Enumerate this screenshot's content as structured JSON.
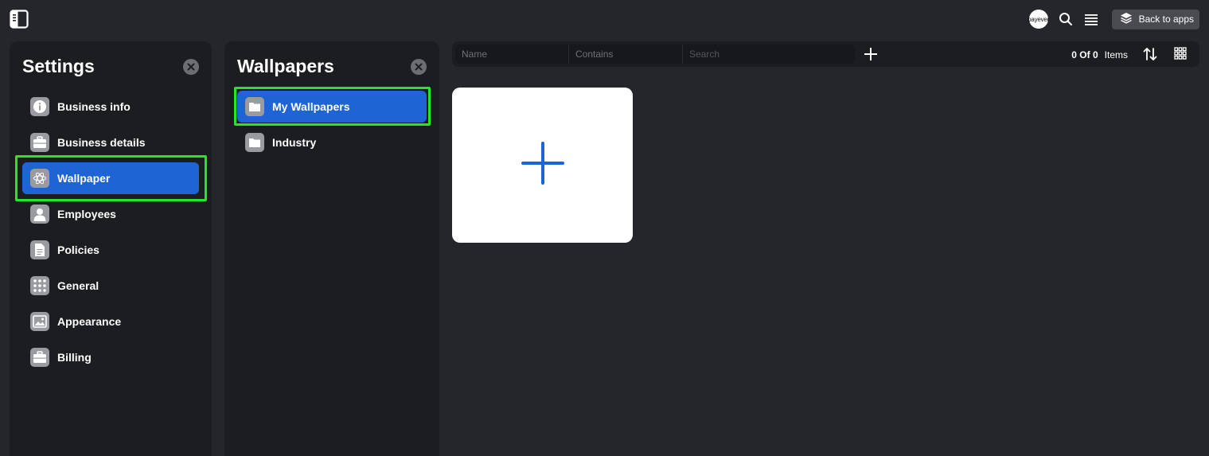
{
  "topbar": {
    "avatar_text": "payever",
    "back_label": "Back to apps"
  },
  "settings": {
    "title": "Settings",
    "items": [
      {
        "label": "Business info",
        "icon": "info-icon"
      },
      {
        "label": "Business details",
        "icon": "briefcase-icon"
      },
      {
        "label": "Wallpaper",
        "icon": "wallpaper-icon",
        "active": true
      },
      {
        "label": "Employees",
        "icon": "person-icon"
      },
      {
        "label": "Policies",
        "icon": "document-icon"
      },
      {
        "label": "General",
        "icon": "grid-dots-icon"
      },
      {
        "label": "Appearance",
        "icon": "image-icon"
      },
      {
        "label": "Billing",
        "icon": "briefcase-icon"
      }
    ]
  },
  "wallpapers": {
    "title": "Wallpapers",
    "folders": [
      {
        "label": "My Wallpapers",
        "icon": "folder-icon",
        "active": true
      },
      {
        "label": "Industry",
        "icon": "folder-icon"
      }
    ]
  },
  "toolbar": {
    "filter_name": "Name",
    "filter_condition": "Contains",
    "search_placeholder": "Search",
    "count_value": "0 Of 0",
    "count_unit": "Items"
  },
  "colors": {
    "accent": "#1e64d4",
    "highlight": "#22e82a",
    "background": "#25262b",
    "panel": "#1c1d21"
  }
}
